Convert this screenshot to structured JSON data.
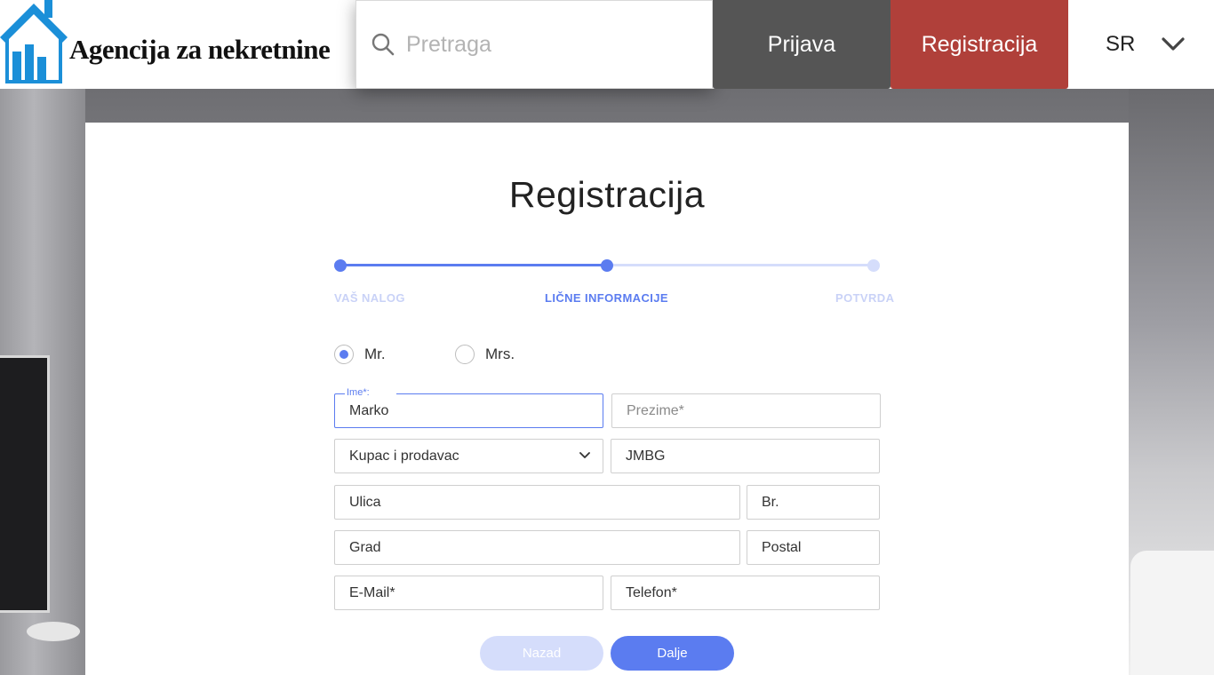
{
  "header": {
    "logo_text": "Agencija za nekretnine",
    "search": {
      "placeholder": "Pretraga"
    },
    "login_label": "Prijava",
    "register_label": "Registracija",
    "language": "SR"
  },
  "form": {
    "title": "Registracija",
    "steps": [
      {
        "label": "VAŠ NALOG",
        "state": "done"
      },
      {
        "label": "LIČNE INFORMACIJE",
        "state": "active"
      },
      {
        "label": "POTVRDA",
        "state": "todo"
      }
    ],
    "title_options": [
      {
        "label": "Mr.",
        "selected": true
      },
      {
        "label": "Mrs.",
        "selected": false
      }
    ],
    "fields": {
      "ime": {
        "label": "Ime*:",
        "value": "Marko"
      },
      "prezime": {
        "placeholder": "Prezime*"
      },
      "tip": {
        "value": "Kupac i prodavac"
      },
      "jmbg": {
        "value": "JMBG"
      },
      "ulica": {
        "value": "Ulica"
      },
      "br": {
        "value": "Br."
      },
      "grad": {
        "value": "Grad"
      },
      "postal": {
        "value": "Postal"
      },
      "email": {
        "value": "E-Mail*"
      },
      "telefon": {
        "value": "Telefon*"
      }
    },
    "back_label": "Nazad",
    "next_label": "Dalje"
  },
  "colors": {
    "accent": "#5b7cf0",
    "accent_light": "#d5ddfb",
    "login_bg": "#555555",
    "register_bg": "#b0403a",
    "logo_blue": "#1b8fd8"
  }
}
